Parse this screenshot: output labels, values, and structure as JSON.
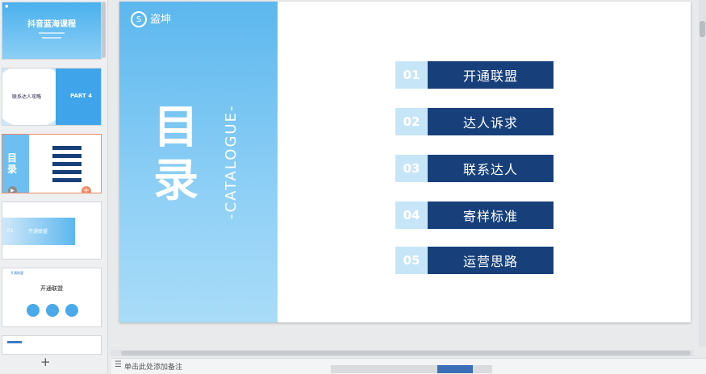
{
  "thumbnails": {
    "t1": {
      "title": "抖音蓝海课程"
    },
    "t2": {
      "title": "联系达人攻略",
      "part": "PART 4"
    },
    "t3": {
      "big": "目录"
    },
    "t4": {
      "num": "01",
      "label": "开通联盟"
    },
    "t5": {
      "header": "开通联盟",
      "title": "开通联盟"
    },
    "add_label": "+"
  },
  "slide": {
    "logo_name": "盗坤",
    "logo_mark": "S",
    "big_title_1": "目",
    "big_title_2": "录",
    "catalogue": "-CATALOGUE-",
    "items": [
      {
        "num": "01",
        "label": "开通联盟"
      },
      {
        "num": "02",
        "label": "达人诉求"
      },
      {
        "num": "03",
        "label": "联系达人"
      },
      {
        "num": "04",
        "label": "寄样标准"
      },
      {
        "num": "05",
        "label": "运营思路"
      }
    ]
  },
  "notes": {
    "placeholder": "单击此处添加备注"
  },
  "colors": {
    "accent": "#17407b",
    "num_bg": "#c6e6f7",
    "left_panel": "#6cbff0",
    "active_border": "#ef8a62"
  }
}
